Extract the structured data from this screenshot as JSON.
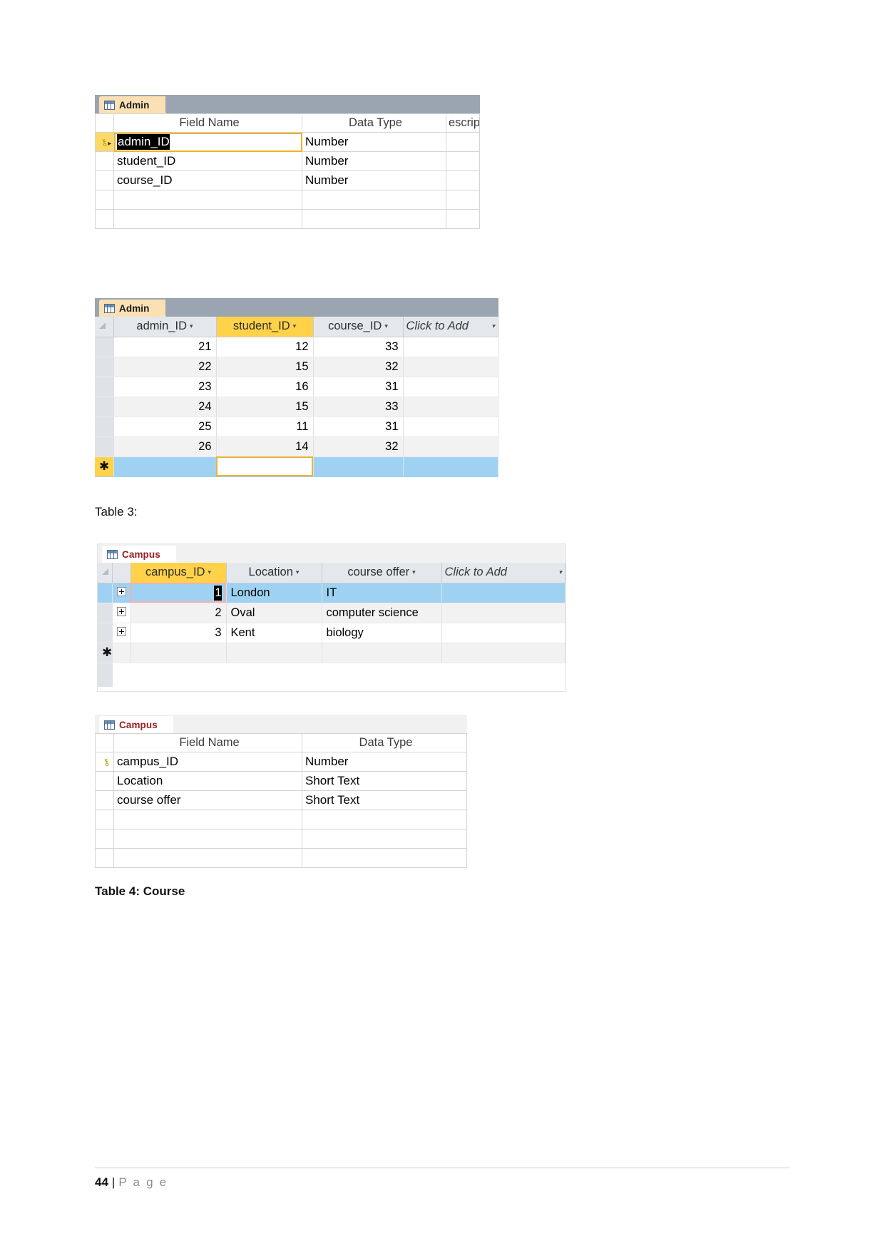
{
  "page": {
    "footer_number": "44",
    "footer_separator": "|",
    "footer_label": "P a g e"
  },
  "captions": {
    "table3": "Table 3:",
    "table4": "Table 4: Course"
  },
  "admin_design": {
    "tab_label": "Admin",
    "tab_icon": "table-grid-icon",
    "headers": {
      "selector": "",
      "field_name": "Field Name",
      "data_type": "Data Type",
      "description": "escrip"
    },
    "rows": [
      {
        "key": "key-icon",
        "marker": "▸",
        "field_name": "admin_ID",
        "data_type": "Number",
        "editing": true
      },
      {
        "key": "",
        "marker": "",
        "field_name": "student_ID",
        "data_type": "Number",
        "editing": false
      },
      {
        "key": "",
        "marker": "",
        "field_name": "course_ID",
        "data_type": "Number",
        "editing": false
      },
      {
        "key": "",
        "marker": "",
        "field_name": "",
        "data_type": "",
        "editing": false
      },
      {
        "key": "",
        "marker": "",
        "field_name": "",
        "data_type": "",
        "editing": false
      }
    ]
  },
  "admin_datasheet": {
    "tab_label": "Admin",
    "tab_icon": "table-grid-icon",
    "columns": [
      {
        "label": "admin_ID",
        "selected": false,
        "caret": "▾"
      },
      {
        "label": "student_ID",
        "selected": true,
        "caret": "▾"
      },
      {
        "label": "course_ID",
        "selected": false,
        "caret": "▾"
      },
      {
        "label": "Click to Add",
        "selected": false,
        "caret": "▾"
      }
    ],
    "rows": [
      {
        "admin_ID": "21",
        "student_ID": "12",
        "course_ID": "33"
      },
      {
        "admin_ID": "22",
        "student_ID": "15",
        "course_ID": "32"
      },
      {
        "admin_ID": "23",
        "student_ID": "16",
        "course_ID": "31"
      },
      {
        "admin_ID": "24",
        "student_ID": "15",
        "course_ID": "33"
      },
      {
        "admin_ID": "25",
        "student_ID": "11",
        "course_ID": "31"
      },
      {
        "admin_ID": "26",
        "student_ID": "14",
        "course_ID": "32"
      }
    ],
    "new_row_marker": "✱"
  },
  "campus_datasheet": {
    "tab_label": "Campus",
    "tab_icon": "table-grid-icon",
    "columns": [
      {
        "label": "campus_ID",
        "selected": true,
        "caret": "▾"
      },
      {
        "label": "Location",
        "selected": false,
        "caret": "▾"
      },
      {
        "label": "course offer",
        "selected": false,
        "caret": "▾"
      },
      {
        "label": "Click to Add",
        "selected": false,
        "caret": "▾"
      }
    ],
    "rows": [
      {
        "expand": "+",
        "campus_ID": "1",
        "Location": "London",
        "course_offer": "IT",
        "selected": true,
        "editing": true
      },
      {
        "expand": "+",
        "campus_ID": "2",
        "Location": "Oval",
        "course_offer": "computer science",
        "selected": false,
        "editing": false
      },
      {
        "expand": "+",
        "campus_ID": "3",
        "Location": "Kent",
        "course_offer": "biology",
        "selected": false,
        "editing": false
      }
    ],
    "new_row_marker": "✱"
  },
  "campus_design": {
    "tab_label": "Campus",
    "tab_icon": "table-grid-icon",
    "headers": {
      "field_name": "Field Name",
      "data_type": "Data Type"
    },
    "rows": [
      {
        "key": "key-icon",
        "field_name": "campus_ID",
        "data_type": "Number"
      },
      {
        "key": "",
        "field_name": "Location",
        "data_type": "Short Text"
      },
      {
        "key": "",
        "field_name": "course offer",
        "data_type": "Short Text"
      },
      {
        "key": "",
        "field_name": "",
        "data_type": ""
      },
      {
        "key": "",
        "field_name": "",
        "data_type": ""
      },
      {
        "key": "",
        "field_name": "",
        "data_type": ""
      }
    ]
  }
}
